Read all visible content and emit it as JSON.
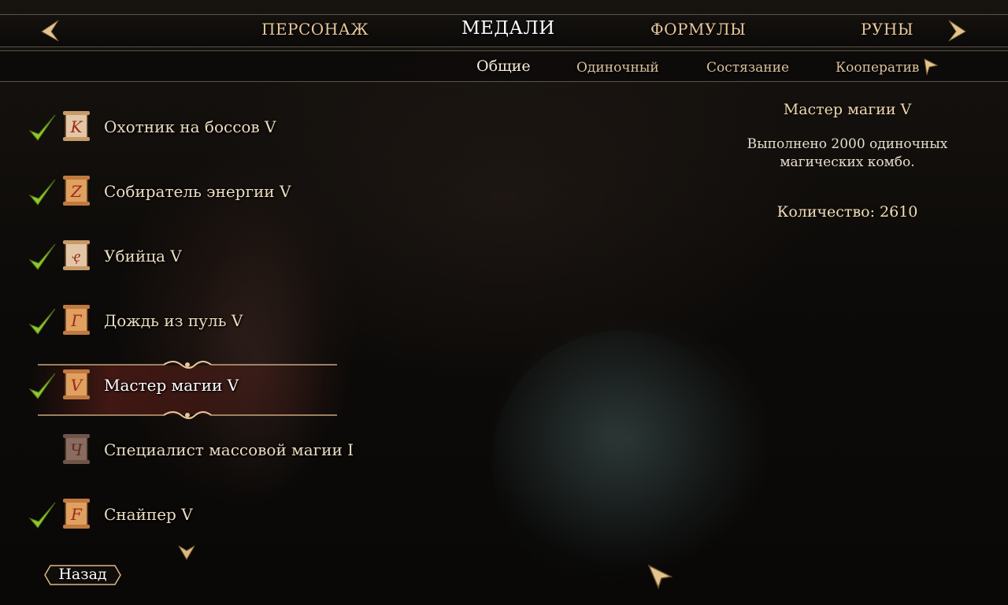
{
  "top_tabs": [
    {
      "label": "ПЕРСОНАЖ"
    },
    {
      "label": "МЕДАЛИ"
    },
    {
      "label": "ФОРМУЛЫ"
    },
    {
      "label": "РУНЫ"
    }
  ],
  "top_tabs_active": "МЕДАЛИ",
  "sub_tabs": [
    {
      "label": "Общие"
    },
    {
      "label": "Одиночный"
    },
    {
      "label": "Состязание"
    },
    {
      "label": "Кооператив"
    }
  ],
  "sub_tabs_active": "Общие",
  "medals": [
    {
      "label": "Охотник на боссов V",
      "completed": true,
      "glyph": "K",
      "scroll_color": "#e3c6a6"
    },
    {
      "label": "Собиратель энергии V",
      "completed": true,
      "glyph": "Z",
      "scroll_color": "#e0a060"
    },
    {
      "label": "Убийца V",
      "completed": true,
      "glyph": "ҿ",
      "scroll_color": "#e3c6a6"
    },
    {
      "label": "Дождь из пуль V",
      "completed": true,
      "glyph": "Г",
      "scroll_color": "#e0a060"
    },
    {
      "label": "Мастер магии V",
      "completed": true,
      "glyph": "V",
      "scroll_color": "#e0a060",
      "selected": true
    },
    {
      "label": "Специалист массовой магии I",
      "completed": false,
      "glyph": "Ч",
      "scroll_color": "#8a6b60"
    },
    {
      "label": "Снайпер V",
      "completed": true,
      "glyph": "F",
      "scroll_color": "#e0a060"
    }
  ],
  "detail": {
    "title": "Мастер магии V",
    "description": "Выполнено 2000 одиночных магических комбо.",
    "quantity": "Количество: 2610"
  },
  "back_button": {
    "label": "Назад"
  },
  "colors": {
    "accent": "#e7c79a",
    "check": "#8fc82e",
    "selection": "#6e231c"
  },
  "icons": {
    "prev": "arrow-left-icon",
    "next": "arrow-right-icon",
    "check": "checkmark-icon",
    "scroll_down": "chevron-down-icon"
  }
}
